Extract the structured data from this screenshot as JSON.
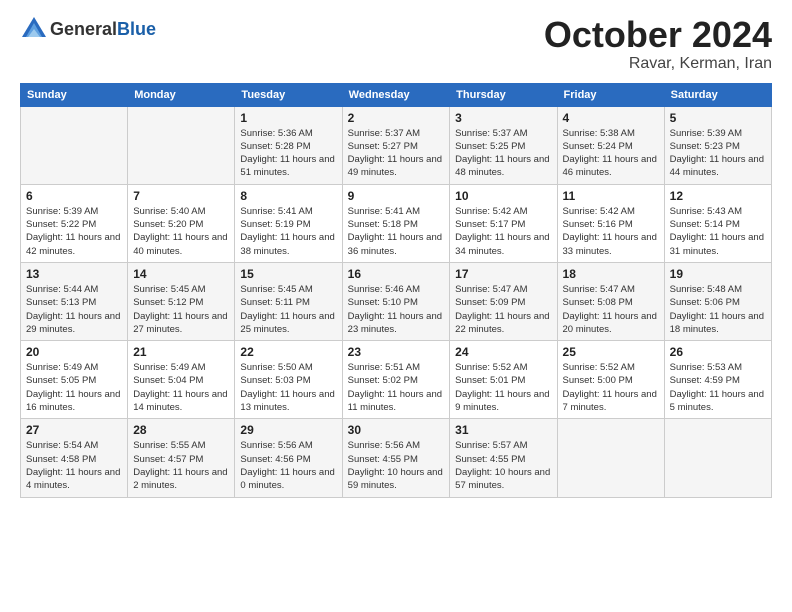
{
  "header": {
    "logo_general": "General",
    "logo_blue": "Blue",
    "month_title": "October 2024",
    "location": "Ravar, Kerman, Iran"
  },
  "days_of_week": [
    "Sunday",
    "Monday",
    "Tuesday",
    "Wednesday",
    "Thursday",
    "Friday",
    "Saturday"
  ],
  "weeks": [
    [
      {
        "day": "",
        "detail": ""
      },
      {
        "day": "",
        "detail": ""
      },
      {
        "day": "1",
        "detail": "Sunrise: 5:36 AM\nSunset: 5:28 PM\nDaylight: 11 hours and 51 minutes."
      },
      {
        "day": "2",
        "detail": "Sunrise: 5:37 AM\nSunset: 5:27 PM\nDaylight: 11 hours and 49 minutes."
      },
      {
        "day": "3",
        "detail": "Sunrise: 5:37 AM\nSunset: 5:25 PM\nDaylight: 11 hours and 48 minutes."
      },
      {
        "day": "4",
        "detail": "Sunrise: 5:38 AM\nSunset: 5:24 PM\nDaylight: 11 hours and 46 minutes."
      },
      {
        "day": "5",
        "detail": "Sunrise: 5:39 AM\nSunset: 5:23 PM\nDaylight: 11 hours and 44 minutes."
      }
    ],
    [
      {
        "day": "6",
        "detail": "Sunrise: 5:39 AM\nSunset: 5:22 PM\nDaylight: 11 hours and 42 minutes."
      },
      {
        "day": "7",
        "detail": "Sunrise: 5:40 AM\nSunset: 5:20 PM\nDaylight: 11 hours and 40 minutes."
      },
      {
        "day": "8",
        "detail": "Sunrise: 5:41 AM\nSunset: 5:19 PM\nDaylight: 11 hours and 38 minutes."
      },
      {
        "day": "9",
        "detail": "Sunrise: 5:41 AM\nSunset: 5:18 PM\nDaylight: 11 hours and 36 minutes."
      },
      {
        "day": "10",
        "detail": "Sunrise: 5:42 AM\nSunset: 5:17 PM\nDaylight: 11 hours and 34 minutes."
      },
      {
        "day": "11",
        "detail": "Sunrise: 5:42 AM\nSunset: 5:16 PM\nDaylight: 11 hours and 33 minutes."
      },
      {
        "day": "12",
        "detail": "Sunrise: 5:43 AM\nSunset: 5:14 PM\nDaylight: 11 hours and 31 minutes."
      }
    ],
    [
      {
        "day": "13",
        "detail": "Sunrise: 5:44 AM\nSunset: 5:13 PM\nDaylight: 11 hours and 29 minutes."
      },
      {
        "day": "14",
        "detail": "Sunrise: 5:45 AM\nSunset: 5:12 PM\nDaylight: 11 hours and 27 minutes."
      },
      {
        "day": "15",
        "detail": "Sunrise: 5:45 AM\nSunset: 5:11 PM\nDaylight: 11 hours and 25 minutes."
      },
      {
        "day": "16",
        "detail": "Sunrise: 5:46 AM\nSunset: 5:10 PM\nDaylight: 11 hours and 23 minutes."
      },
      {
        "day": "17",
        "detail": "Sunrise: 5:47 AM\nSunset: 5:09 PM\nDaylight: 11 hours and 22 minutes."
      },
      {
        "day": "18",
        "detail": "Sunrise: 5:47 AM\nSunset: 5:08 PM\nDaylight: 11 hours and 20 minutes."
      },
      {
        "day": "19",
        "detail": "Sunrise: 5:48 AM\nSunset: 5:06 PM\nDaylight: 11 hours and 18 minutes."
      }
    ],
    [
      {
        "day": "20",
        "detail": "Sunrise: 5:49 AM\nSunset: 5:05 PM\nDaylight: 11 hours and 16 minutes."
      },
      {
        "day": "21",
        "detail": "Sunrise: 5:49 AM\nSunset: 5:04 PM\nDaylight: 11 hours and 14 minutes."
      },
      {
        "day": "22",
        "detail": "Sunrise: 5:50 AM\nSunset: 5:03 PM\nDaylight: 11 hours and 13 minutes."
      },
      {
        "day": "23",
        "detail": "Sunrise: 5:51 AM\nSunset: 5:02 PM\nDaylight: 11 hours and 11 minutes."
      },
      {
        "day": "24",
        "detail": "Sunrise: 5:52 AM\nSunset: 5:01 PM\nDaylight: 11 hours and 9 minutes."
      },
      {
        "day": "25",
        "detail": "Sunrise: 5:52 AM\nSunset: 5:00 PM\nDaylight: 11 hours and 7 minutes."
      },
      {
        "day": "26",
        "detail": "Sunrise: 5:53 AM\nSunset: 4:59 PM\nDaylight: 11 hours and 5 minutes."
      }
    ],
    [
      {
        "day": "27",
        "detail": "Sunrise: 5:54 AM\nSunset: 4:58 PM\nDaylight: 11 hours and 4 minutes."
      },
      {
        "day": "28",
        "detail": "Sunrise: 5:55 AM\nSunset: 4:57 PM\nDaylight: 11 hours and 2 minutes."
      },
      {
        "day": "29",
        "detail": "Sunrise: 5:56 AM\nSunset: 4:56 PM\nDaylight: 11 hours and 0 minutes."
      },
      {
        "day": "30",
        "detail": "Sunrise: 5:56 AM\nSunset: 4:55 PM\nDaylight: 10 hours and 59 minutes."
      },
      {
        "day": "31",
        "detail": "Sunrise: 5:57 AM\nSunset: 4:55 PM\nDaylight: 10 hours and 57 minutes."
      },
      {
        "day": "",
        "detail": ""
      },
      {
        "day": "",
        "detail": ""
      }
    ]
  ]
}
